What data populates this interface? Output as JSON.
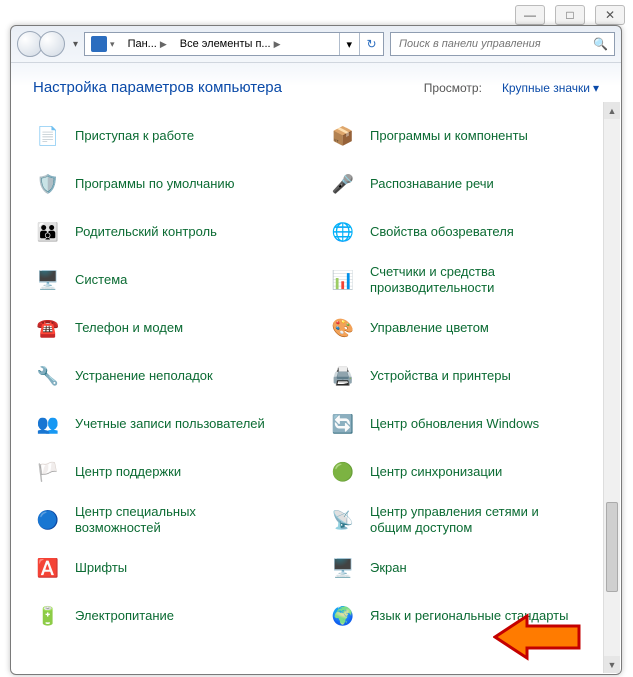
{
  "titlebar": {
    "minimize": "—",
    "maximize": "□",
    "close": "✕"
  },
  "nav": {
    "breadcrumb": {
      "seg1": "Пан...",
      "seg2": "Все элементы п...",
      "seg_caret": "▶"
    },
    "refresh_glyph": "↻",
    "search_placeholder": "Поиск в панели управления"
  },
  "header": {
    "title": "Настройка параметров компьютера",
    "view_label": "Просмотр:",
    "view_value": "Крупные значки"
  },
  "items_left": [
    {
      "label": "Приступая к работе",
      "icon": "📄"
    },
    {
      "label": "Программы по умолчанию",
      "icon": "🛡️"
    },
    {
      "label": "Родительский контроль",
      "icon": "👪"
    },
    {
      "label": "Система",
      "icon": "🖥️"
    },
    {
      "label": "Телефон и модем",
      "icon": "☎️"
    },
    {
      "label": "Устранение неполадок",
      "icon": "🔧"
    },
    {
      "label": "Учетные записи пользователей",
      "icon": "👥"
    },
    {
      "label": "Центр поддержки",
      "icon": "🏳️"
    },
    {
      "label": "Центр специальных возможностей",
      "icon": "🔵"
    },
    {
      "label": "Шрифты",
      "icon": "🅰️"
    },
    {
      "label": "Электропитание",
      "icon": "🔋"
    }
  ],
  "items_right": [
    {
      "label": "Программы и компоненты",
      "icon": "📦"
    },
    {
      "label": "Распознавание речи",
      "icon": "🎤"
    },
    {
      "label": "Свойства обозревателя",
      "icon": "🌐"
    },
    {
      "label": "Счетчики и средства производительности",
      "icon": "📊"
    },
    {
      "label": "Управление цветом",
      "icon": "🎨"
    },
    {
      "label": "Устройства и принтеры",
      "icon": "🖨️"
    },
    {
      "label": "Центр обновления Windows",
      "icon": "🔄"
    },
    {
      "label": "Центр синхронизации",
      "icon": "🟢"
    },
    {
      "label": "Центр управления сетями и общим доступом",
      "icon": "📡"
    },
    {
      "label": "Экран",
      "icon": "🖥️"
    },
    {
      "label": "Язык и региональные стандарты",
      "icon": "🌍"
    }
  ]
}
